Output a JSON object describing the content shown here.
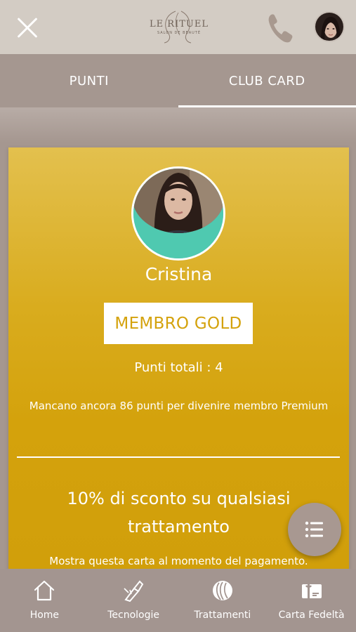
{
  "header": {
    "logo_text": "LE RITUEL",
    "logo_sub": "SALON DE BEAUTÉ",
    "close_icon": "close-icon",
    "phone_icon": "phone-icon"
  },
  "tabs": [
    {
      "label": "PUNTI",
      "active": false
    },
    {
      "label": "CLUB CARD",
      "active": true
    }
  ],
  "card": {
    "name": "Cristina",
    "badge": "MEMBRO GOLD",
    "points_total": "Punti totali : 4",
    "remaining": "Mancano ancora 86 punti per divenire membro Premium",
    "offer": "10% di sconto su qualsiasi trattamento",
    "show_card": "Mostra questa carta al momento del pagamento."
  },
  "fab": {
    "icon": "list-icon"
  },
  "nav": [
    {
      "label": "Home",
      "icon": "home-icon"
    },
    {
      "label": "Tecnologie",
      "icon": "laser-icon"
    },
    {
      "label": "Trattamenti",
      "icon": "hair-icon"
    },
    {
      "label": "Carta Fedeltà",
      "icon": "gift-card-icon"
    }
  ],
  "colors": {
    "header_bg": "#d3ccc4",
    "tabs_bg": "#a59790",
    "card_gold": "#d4a20c",
    "avatar_ring": "#4fc9b0"
  }
}
